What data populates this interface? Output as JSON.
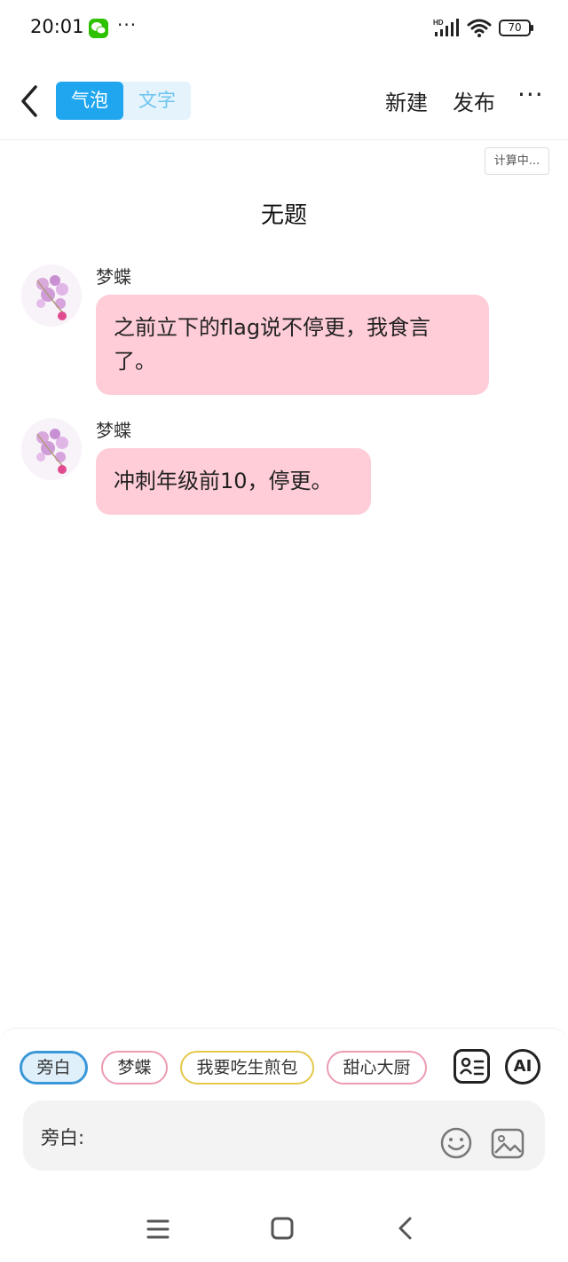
{
  "status_bar": {
    "time": "20:01",
    "app_icon": "wechat-icon",
    "more": "···",
    "network": "HD",
    "battery": "70"
  },
  "nav": {
    "back_icon": "chevron-left-icon",
    "mode_bubble": "气泡",
    "mode_text": "文字",
    "new_label": "新建",
    "publish_label": "发布",
    "more_label": "···"
  },
  "calc_badge": "计算中...",
  "document": {
    "title": "无题",
    "messages": [
      {
        "sender": "梦蝶",
        "text": "之前立下的flag说不停更，我食言了。"
      },
      {
        "sender": "梦蝶",
        "text": "冲刺年级前10，停更。"
      }
    ]
  },
  "composer": {
    "chips": [
      "旁白",
      "梦蝶",
      "我要吃生煎包",
      "甜心大厨"
    ],
    "ai_label": "AI",
    "input_label": "旁白:",
    "icons": [
      "contact-card-icon",
      "smile-icon",
      "image-icon"
    ]
  },
  "colors": {
    "accent": "#1fa6ef",
    "bubble": "#ffcdd8",
    "chip_active": "#3b98d8",
    "chip_pink": "#ec9bb1",
    "chip_yellow": "#e3c84a"
  }
}
